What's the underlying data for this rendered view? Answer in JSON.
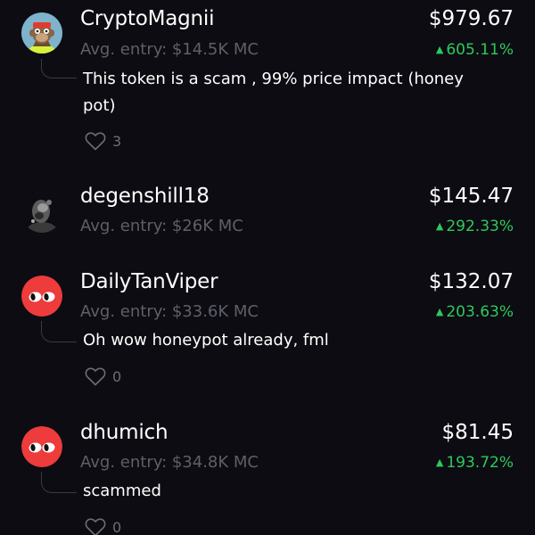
{
  "posts": [
    {
      "username": "CryptoMagnii",
      "entry": "Avg. entry: $14.5K MC",
      "value": "$979.67",
      "change": "605.11%",
      "comment": "This token is a scam , 99% price impact (honey pot)",
      "likes": "3",
      "avatar_icon": "ape-avatar-icon"
    },
    {
      "username": "degenshill18",
      "entry": "Avg. entry: $26K MC",
      "value": "$145.47",
      "change": "292.33%",
      "avatar_icon": "dark-figure-avatar-icon"
    },
    {
      "username": "DailyTanViper",
      "entry": "Avg. entry: $33.6K MC",
      "value": "$132.07",
      "change": "203.63%",
      "comment": "Oh wow honeypot already, fml",
      "likes": "0",
      "avatar_icon": "red-eyes-avatar-icon"
    },
    {
      "username": "dhumich",
      "entry": "Avg. entry: $34.8K MC",
      "value": "$81.45",
      "change": "193.72%",
      "comment": "scammed",
      "likes": "0",
      "avatar_icon": "red-eyes-avatar-icon"
    }
  ],
  "colors": {
    "background": "#0c0c12",
    "positive": "#2ec95c",
    "muted": "#5e5f69",
    "avatar_red": "#ee3b3b"
  },
  "icons": {
    "up_arrow": "▲",
    "like": "heart-icon"
  }
}
